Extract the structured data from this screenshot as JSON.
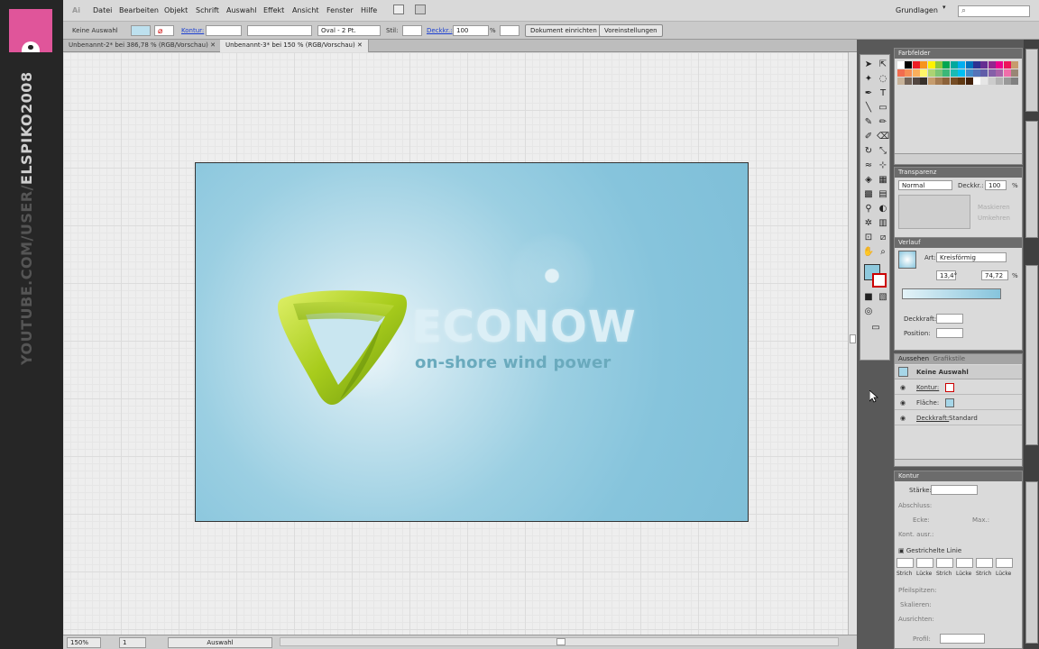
{
  "watermark": {
    "prefix": "YOUTUBE.COM/USER/",
    "name": "ELSPIKO2008"
  },
  "app": {
    "logo": "Ai",
    "workspace": "Grundlagen"
  },
  "menu": [
    "Datei",
    "Bearbeiten",
    "Objekt",
    "Schrift",
    "Auswahl",
    "Effekt",
    "Ansicht",
    "Fenster",
    "Hilfe"
  ],
  "control": {
    "selection": "Keine Auswahl",
    "stroke_label": "Kontur:",
    "brush": "Oval - 2 Pt.",
    "style_label": "Stil:",
    "opacity_label": "Deckkr.:",
    "opacity": "100",
    "percent": "%",
    "doc_setup": "Dokument einrichten",
    "prefs": "Voreinstellungen"
  },
  "tabs": [
    "Unbenannt-2* bei 386,78 % (RGB/Vorschau)",
    "Unbenannt-3* bei 150 % (RGB/Vorschau)"
  ],
  "artwork": {
    "brand": "ECONOW",
    "tagline": "on-shore wind power"
  },
  "status": {
    "zoom": "150%",
    "artboard": "1",
    "mode": "Auswahl"
  },
  "panels": {
    "swatches": {
      "title": "Farbfelder"
    },
    "transparency": {
      "title": "Transparenz",
      "mode": "Normal",
      "opacity_label": "Deckkr.:",
      "opacity": "100",
      "pct": "%",
      "check1": "Maskieren",
      "check2": "Umkehren"
    },
    "gradient": {
      "title": "Verlauf",
      "type_label": "Art:",
      "type": "Kreisförmig",
      "angle": "13,4°",
      "ratio": "74,72",
      "pct": "%",
      "opacity_label": "Deckkraft:",
      "position_label": "Position:"
    },
    "appearance": {
      "tab1": "Aussehen",
      "tab2": "Grafikstile",
      "header": "Keine Auswahl",
      "stroke": "Kontur:",
      "fill": "Fläche:",
      "opacity": "Deckkraft:",
      "opacity_value": "Standard"
    },
    "stroke": {
      "title": "Kontur",
      "weight": "Stärke:",
      "cap": "Abschluss:",
      "corner": "Ecke:",
      "limit": "Max.:",
      "align": "Kont. ausr.:",
      "dashed": "Gestrichelte Linie",
      "dash_labels": [
        "Strich",
        "Lücke",
        "Strich",
        "Lücke",
        "Strich",
        "Lücke"
      ],
      "arrows": "Pfeilspitzen:",
      "scale": "Skalieren:",
      "alignarrows": "Ausrichten:",
      "profile": "Profil:"
    }
  },
  "colors": {
    "accent": "#86c4dc",
    "logo_green": "#9cc414",
    "menubar": "#d9d9d9"
  }
}
